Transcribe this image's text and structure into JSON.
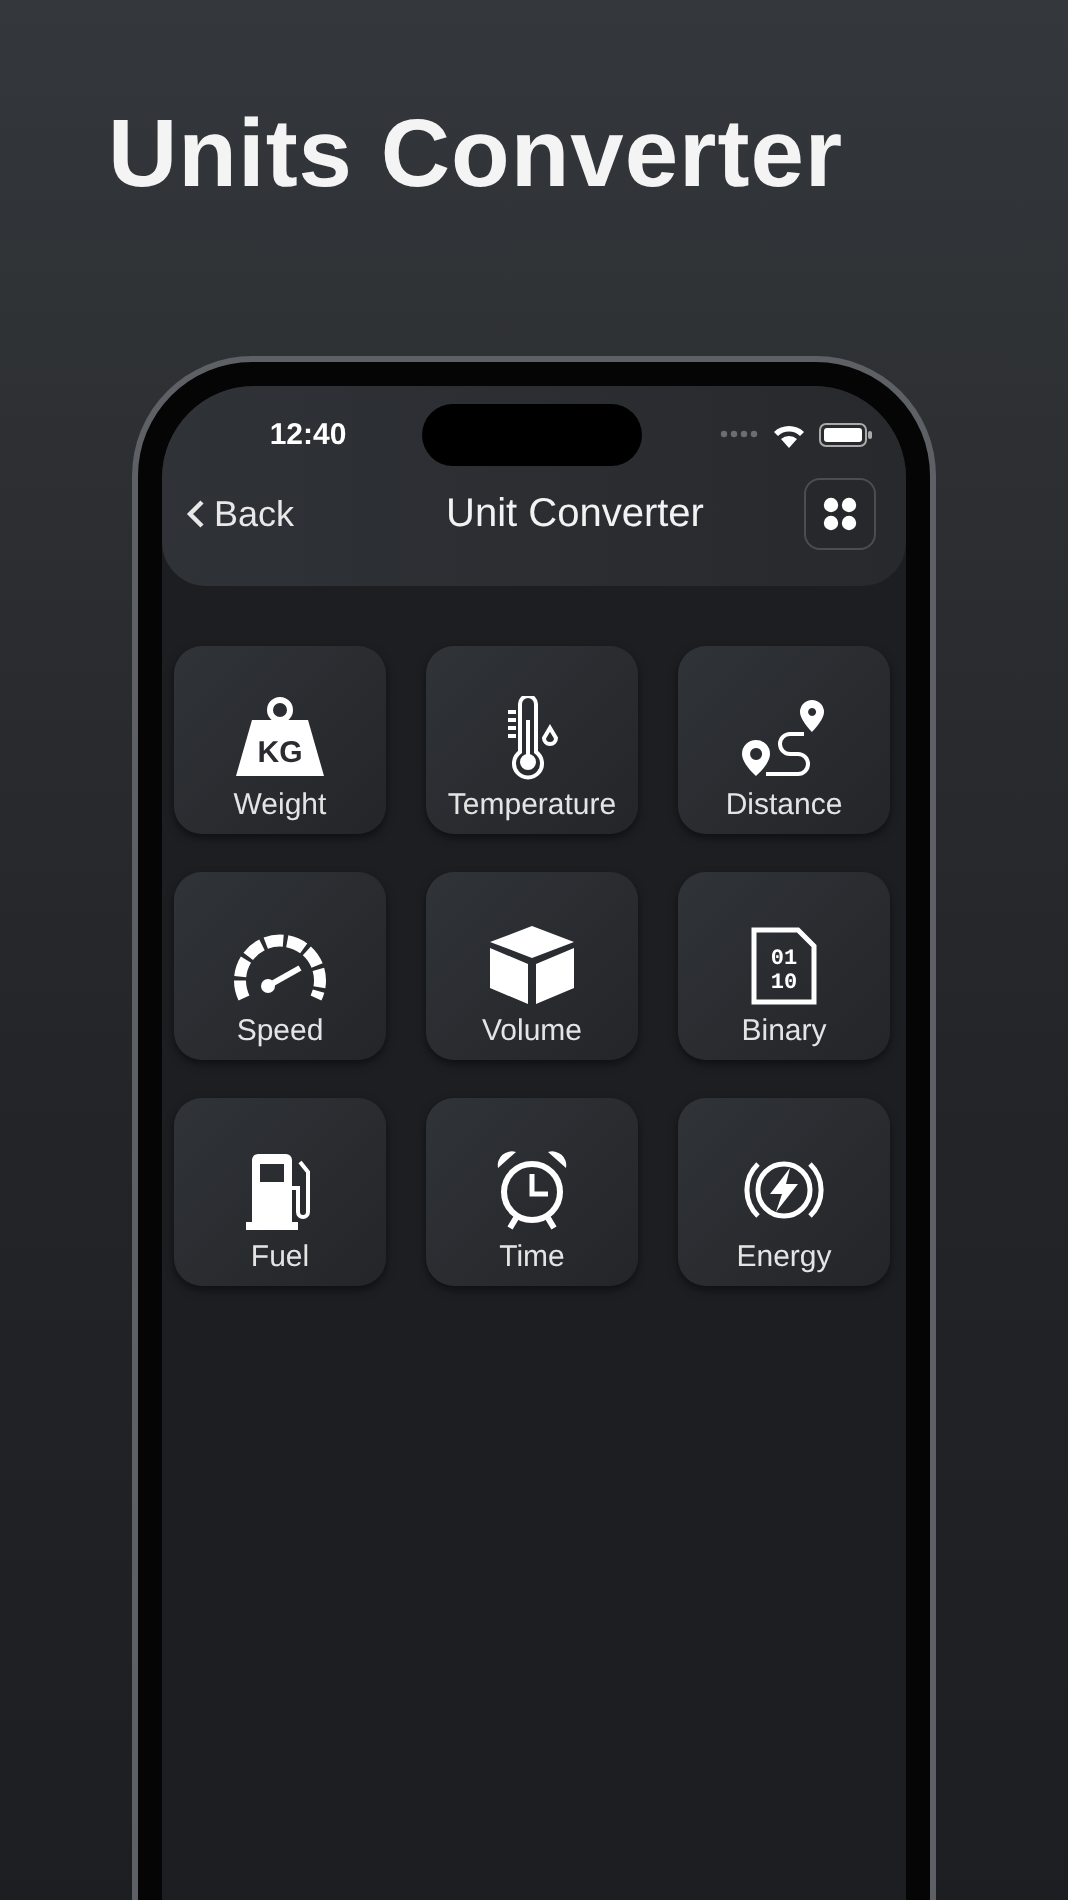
{
  "headline": "Units Converter",
  "status_bar": {
    "time": "12:40"
  },
  "nav": {
    "back": "Back",
    "title": "Unit Converter"
  },
  "tiles": [
    {
      "kind": "weight",
      "label": "Weight",
      "icon_text": [
        "KG"
      ]
    },
    {
      "kind": "temperature",
      "label": "Temperature"
    },
    {
      "kind": "distance",
      "label": "Distance"
    },
    {
      "kind": "speed",
      "label": "Speed"
    },
    {
      "kind": "volume",
      "label": "Volume"
    },
    {
      "kind": "binary",
      "label": "Binary",
      "icon_text": [
        "01",
        "10"
      ]
    },
    {
      "kind": "fuel",
      "label": "Fuel"
    },
    {
      "kind": "time",
      "label": "Time"
    },
    {
      "kind": "energy",
      "label": "Energy"
    }
  ]
}
